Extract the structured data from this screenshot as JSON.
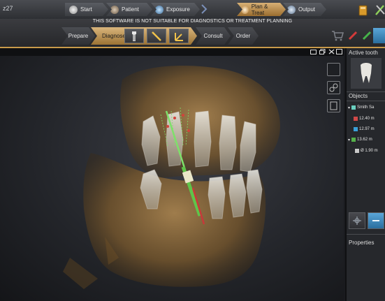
{
  "app": {
    "window_fragment": "z27"
  },
  "top_tabs": [
    {
      "label": "Start",
      "state": "normal"
    },
    {
      "label": "Patient",
      "state": "normal"
    },
    {
      "label": "Exposure",
      "state": "normal"
    },
    {
      "label": "Plan & Treat",
      "state": "active"
    },
    {
      "label": "Output",
      "state": "normal"
    }
  ],
  "warning_text": "THIS SOFTWARE IS NOT SUITABLE FOR DIAGNOSTICS OR TREATMENT PLANNING",
  "workflow": {
    "left_fragment": "",
    "steps": [
      "Prepare",
      "Diagnose",
      "Consult",
      "Order"
    ],
    "diagnose_tools": [
      "implant-tool-icon",
      "line-measure-icon",
      "angle-measure-icon"
    ]
  },
  "right_panel": {
    "active_tooth_title": "Active tooth",
    "objects_title": "Objects",
    "objects": [
      {
        "label": "Smith Sa",
        "color": "#6ad0c0",
        "indent": 0
      },
      {
        "label": "12.40 m",
        "color": "#d04848",
        "indent": 1
      },
      {
        "label": "12.97 m",
        "color": "#3aa0d8",
        "indent": 1
      },
      {
        "label": "13.62 m",
        "color": "#55b04a",
        "indent": 0
      },
      {
        "label": "Ø 1.90 m",
        "color": "#c8c8c8",
        "indent": 1
      }
    ],
    "properties_title": "Properties"
  },
  "colors": {
    "accent": "#c89a4a",
    "implant_green": "#7ee06a",
    "implant_red": "#d0453b",
    "bone": "#8a6a3d"
  }
}
